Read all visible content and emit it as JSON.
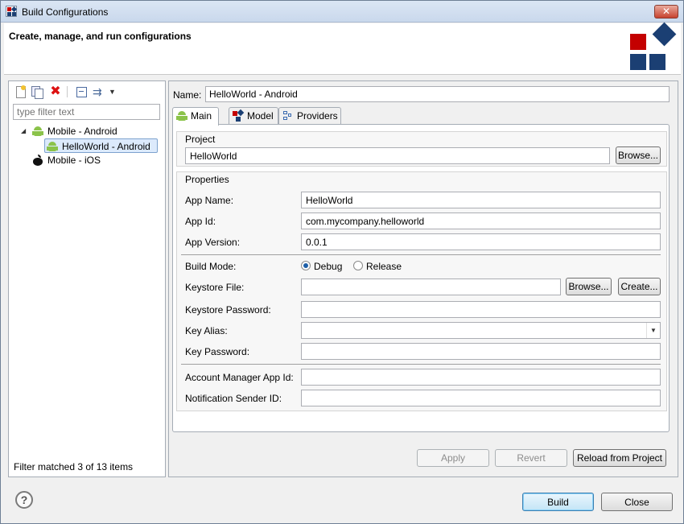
{
  "window": {
    "title": "Build Configurations",
    "close_glyph": "✕"
  },
  "header": {
    "title": "Create, manage, and run configurations"
  },
  "left": {
    "toolbar": {
      "delete_glyph": "✖",
      "filter_glyph": "⇉",
      "menu_glyph": "▼"
    },
    "filter_placeholder": "type filter text",
    "tree": [
      {
        "label": "Mobile - Android",
        "icon": "android-icon",
        "expanded": true,
        "twisty": "◢"
      },
      {
        "label": "HelloWorld - Android",
        "icon": "android-icon",
        "selected": true
      },
      {
        "label": "Mobile - iOS",
        "icon": "apple-icon"
      }
    ],
    "status": "Filter matched 3 of 13 items"
  },
  "right": {
    "name_label": "Name:",
    "name_value": "HelloWorld - Android",
    "tabs": [
      {
        "label": "Main",
        "icon": "android-icon",
        "active": true
      },
      {
        "label": "Model",
        "icon": "model-icon"
      },
      {
        "label": "Providers",
        "icon": "providers-icon"
      }
    ],
    "project": {
      "group_label": "Project",
      "value": "HelloWorld",
      "browse_label": "Browse..."
    },
    "properties": {
      "group_label": "Properties",
      "app_name_label": "App Name:",
      "app_name_value": "HelloWorld",
      "app_id_label": "App Id:",
      "app_id_value": "com.mycompany.helloworld",
      "app_version_label": "App Version:",
      "app_version_value": "0.0.1",
      "build_mode_label": "Build Mode:",
      "debug_label": "Debug",
      "release_label": "Release",
      "selected_mode": "Debug",
      "keystore_file_label": "Keystore File:",
      "keystore_file_value": "",
      "browse_label": "Browse...",
      "create_label": "Create...",
      "keystore_password_label": "Keystore Password:",
      "key_alias_label": "Key Alias:",
      "key_alias_value": "",
      "key_password_label": "Key Password:",
      "account_manager_label": "Account Manager App Id:",
      "notification_sender_label": "Notification Sender ID:"
    },
    "apply_label": "Apply",
    "revert_label": "Revert",
    "reload_label": "Reload from Project"
  },
  "footer": {
    "help_glyph": "?",
    "build_label": "Build",
    "close_label": "Close"
  },
  "colors": {
    "accent_red": "#c40000",
    "accent_navy": "#1b3f73",
    "android_green": "#8bc34a"
  }
}
